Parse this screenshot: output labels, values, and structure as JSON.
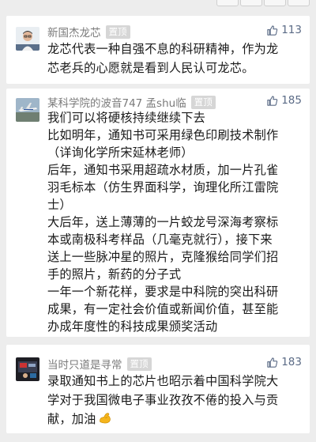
{
  "comments": [
    {
      "author": "新国杰龙芯",
      "pin_label": "置顶",
      "likes": "113",
      "avatar_icon": "person-avatar",
      "lines": [
        "龙芯代表一种自强不息的科研精神，作为龙",
        "芯老兵的心愿就是看到人民认可龙芯。"
      ]
    },
    {
      "author": "某科学院的波音747 孟shu临",
      "pin_label": "置顶",
      "likes": "185",
      "avatar_icon": "airplane-avatar",
      "lines": [
        "我们可以将硬核持续继续下去",
        "比如明年，通知书可采用绿色印刷技术制作",
        "（详询化学所宋延林老师）",
        "后年，通知书采用超疏水材质，加一片孔雀",
        "羽毛标本（仿生界面科学，询理化所江雷院",
        "士）",
        "大后年，送上薄薄的一片蛟龙号深海考察标",
        "本或南极科考样品（几毫克就行），接下来",
        "送上一些脉冲星的照片，克隆猴给同学们招",
        "手的照片，新药的分子式",
        "一年一个新花样，要求是中科院的突出科研",
        "成果，有一定社会价值或新闻价值，甚至能",
        "办成年度性的科技成果颁奖活动"
      ]
    },
    {
      "author": "当时只道是寻常",
      "pin_label": "置顶",
      "likes": "183",
      "avatar_icon": "dark-photo-avatar",
      "lines": [
        "录取通知书上的芯片也昭示着中国科学院大",
        "学对于我国微电子事业孜孜不倦的投入与贡",
        "献，加油"
      ],
      "trailing_emoji": "flexed-biceps-emoji"
    }
  ],
  "colors": {
    "background": "#ededed",
    "card": "#ffffff",
    "name": "#7a7a7a",
    "likes": "#5b6b86",
    "pin_bg": "#d6d6d6"
  }
}
